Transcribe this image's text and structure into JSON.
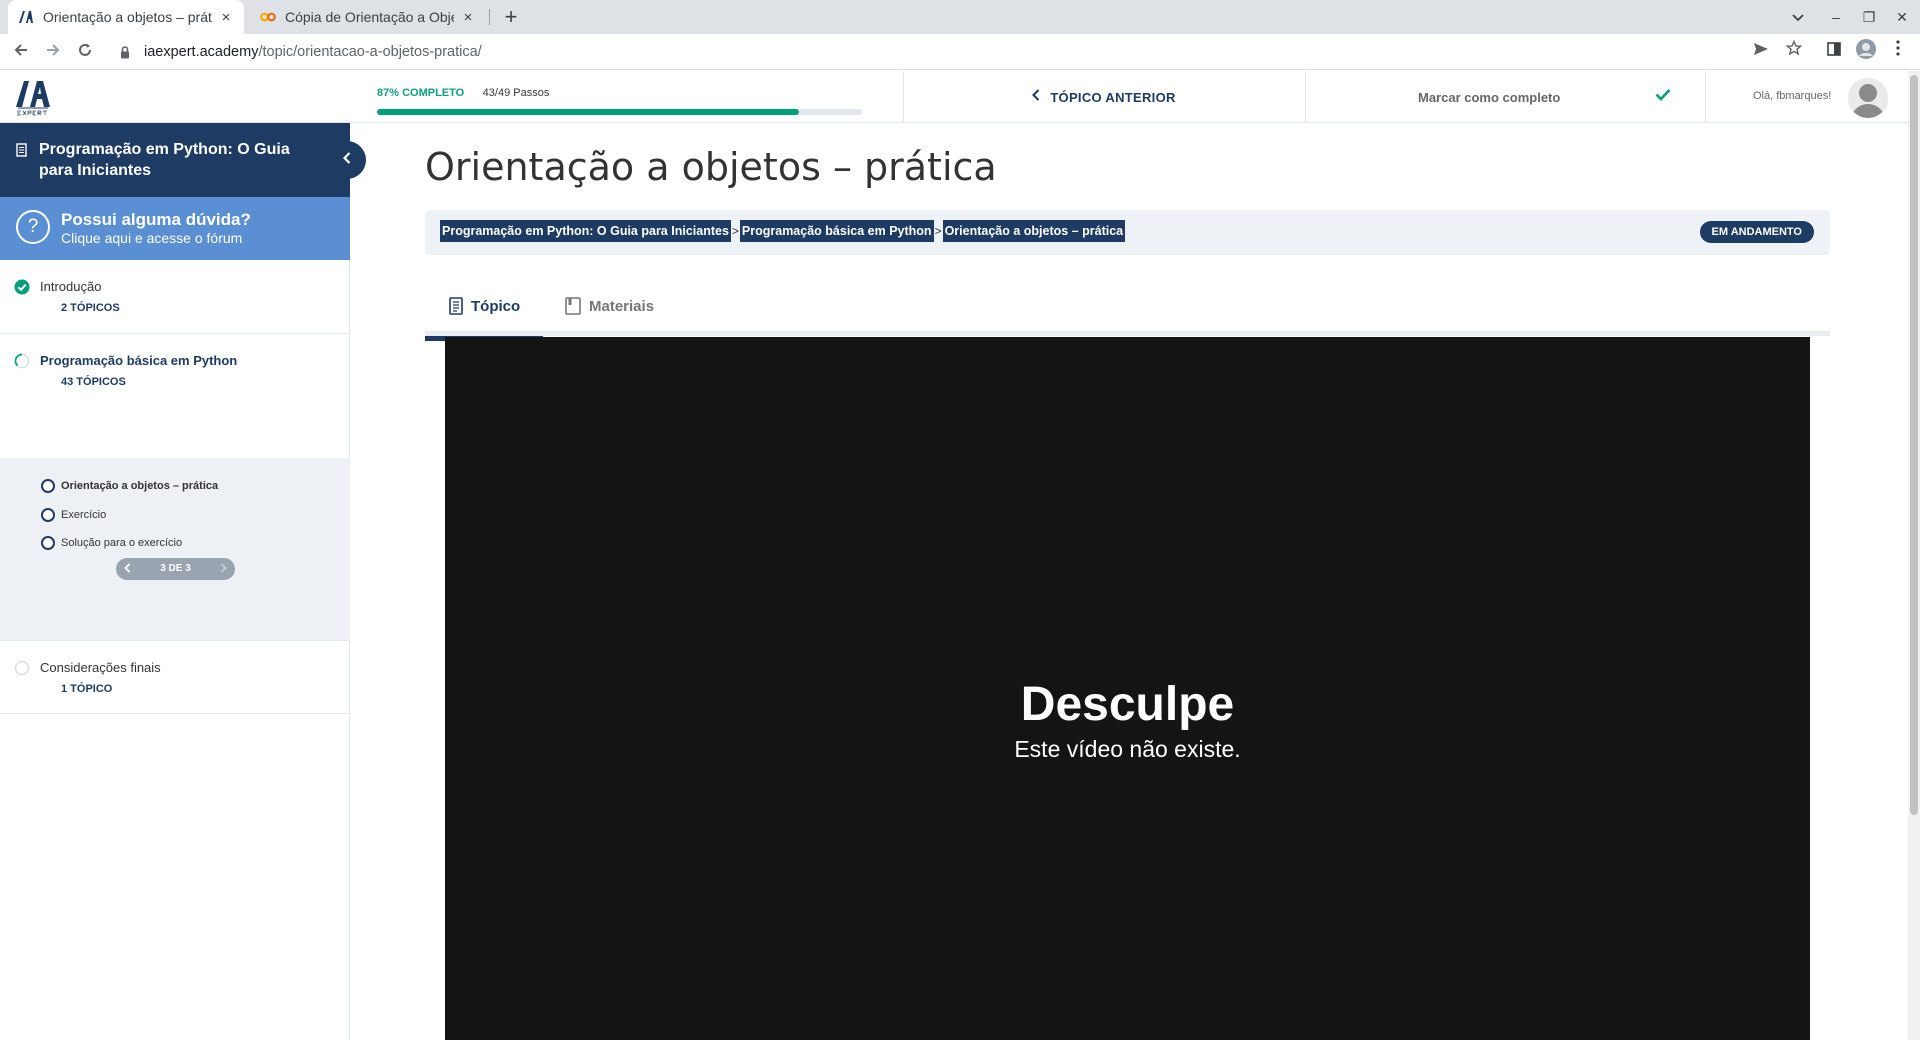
{
  "browser": {
    "tabs": [
      {
        "title": "Orientação a objetos – prática",
        "close": "×"
      },
      {
        "title": "Cópia de Orientação a Objeto",
        "close": "×"
      }
    ],
    "new_tab": "+",
    "url_host": "iaexpert.academy",
    "url_path": "/topic/orientacao-a-objetos-pratica/",
    "window_controls": {
      "minimize": "–",
      "restore": "❐",
      "close": "✕"
    }
  },
  "header": {
    "progress_pct_label": "87% COMPLETO",
    "progress_steps": "43/49 Passos",
    "progress_fraction": 0.87,
    "prev_topic": "TÓPICO ANTERIOR",
    "mark_complete": "Marcar como completo",
    "greeting": "Olá, fbmarques!"
  },
  "sidebar": {
    "course_title": "Programação em Python: O Guia para Iniciantes",
    "forum_title": "Possui alguma dúvida?",
    "forum_subtitle": "Clique aqui e acesse o fórum",
    "lessons": [
      {
        "name": "Introdução",
        "count": "2 TÓPICOS",
        "status": "complete"
      },
      {
        "name": "Programação básica em Python",
        "count": "43 TÓPICOS",
        "status": "in-progress"
      },
      {
        "name": "Considerações finais",
        "count": "1 TÓPICO",
        "status": "not-started"
      }
    ],
    "subtopics": [
      {
        "name": "Orientação a objetos – prática"
      },
      {
        "name": "Exercício"
      },
      {
        "name": "Solução para o exercício"
      }
    ],
    "pager": "3 DE 3"
  },
  "main": {
    "title": "Orientação a objetos – prática",
    "breadcrumbs": [
      "Programação em Python: O Guia para Iniciantes",
      "Programação básica em Python",
      "Orientação a objetos – prática"
    ],
    "breadcrumb_sep": ">",
    "status": "EM ANDAMENTO",
    "tabs": [
      {
        "label": "Tópico"
      },
      {
        "label": "Materiais"
      }
    ],
    "video": {
      "heading": "Desculpe",
      "message": "Este vídeo não existe."
    }
  },
  "colors": {
    "brand_navy": "#1d3b63",
    "progress_green": "#019e7c",
    "forum_blue": "#5b8fd4"
  }
}
